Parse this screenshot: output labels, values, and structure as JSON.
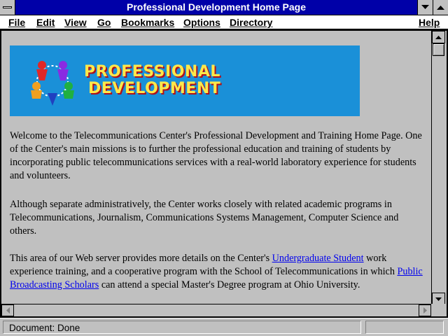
{
  "window": {
    "title": "Professional Development Home Page"
  },
  "menu": {
    "file": "File",
    "edit": "Edit",
    "view": "View",
    "go": "Go",
    "bookmarks": "Bookmarks",
    "options": "Options",
    "directory": "Directory",
    "help": "Help"
  },
  "banner": {
    "line1": "PROFESSIONAL",
    "line2": "DEVELOPMENT",
    "background_color": "#1a90d8",
    "text_color": "#ffe84a"
  },
  "content": {
    "para1": "Welcome to the Telecommunications Center's Professional Development and Training Home Page. One of the Center's main missions is to further the professional education and training of students by incorporating public telecommunications services with a real-world laboratory experience for students and volunteers.",
    "para2": "Although separate administratively, the Center works closely with related academic programs in Telecommunications, Journalism, Communications Systems Management, Computer Science and others.",
    "para3_a": "This area of our Web server provides more details on the Center's ",
    "link_undergrad": "Undergraduate Student",
    "para3_b": " work experience training, and a cooperative program with the School of Telecommunications in which ",
    "link_scholars": "Public Broadcasting Scholars",
    "para3_c": " can attend a special Master's Degree program at Ohio University."
  },
  "status": {
    "text": "Document: Done"
  },
  "colors": {
    "title_bar": "#0000a8",
    "link": "#0000ee",
    "chrome": "#c0c0c0"
  }
}
